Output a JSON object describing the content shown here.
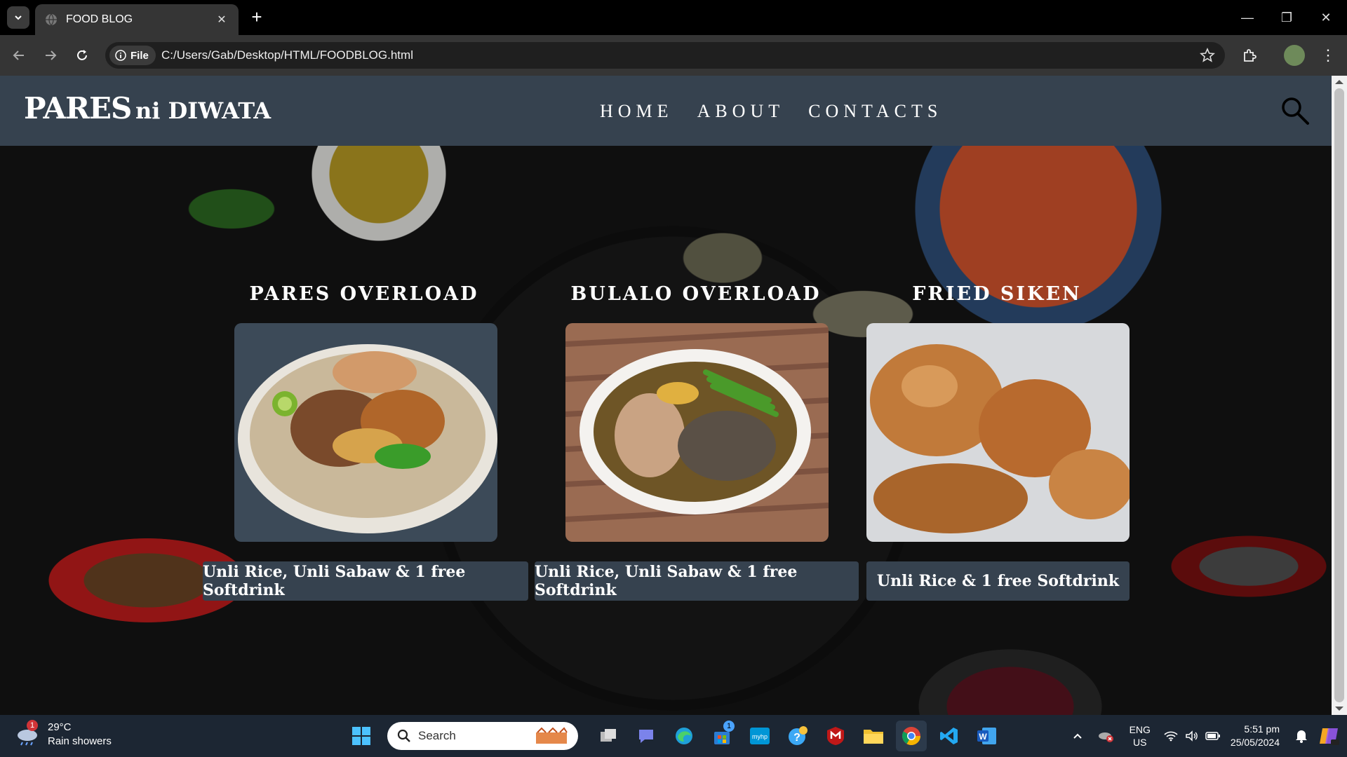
{
  "browser": {
    "tab_title": "FOOD BLOG",
    "chip_label": "File",
    "url": "C:/Users/Gab/Desktop/HTML/FOODBLOG.html"
  },
  "site": {
    "logo_main": "PARES",
    "logo_sub": "ni DIWATA",
    "nav": [
      "HOME",
      "ABOUT",
      "CONTACTS"
    ]
  },
  "cards": [
    {
      "title": "PARES OVERLOAD",
      "offer": "Unli Rice, Unli Sabaw & 1 free Softdrink",
      "image": "pares-bowl"
    },
    {
      "title": "BULALO OVERLOAD",
      "offer": "Unli Rice, Unli Sabaw & 1 free Softdrink",
      "image": "bulalo-bowl"
    },
    {
      "title": "FRIED SIKEN",
      "offer": "Unli Rice & 1 free Softdrink",
      "image": "fried-chicken"
    }
  ],
  "taskbar": {
    "weather_temp": "29°C",
    "weather_desc": "Rain showers",
    "weather_badge": "1",
    "search_placeholder": "Search",
    "store_badge": "1",
    "lang_primary": "ENG",
    "lang_region": "US",
    "time": "5:51 pm",
    "date": "25/05/2024"
  },
  "colors": {
    "header_bg": "#36424f",
    "taskbar_bg": "#1c2633",
    "browser_toolbar": "#353535"
  }
}
